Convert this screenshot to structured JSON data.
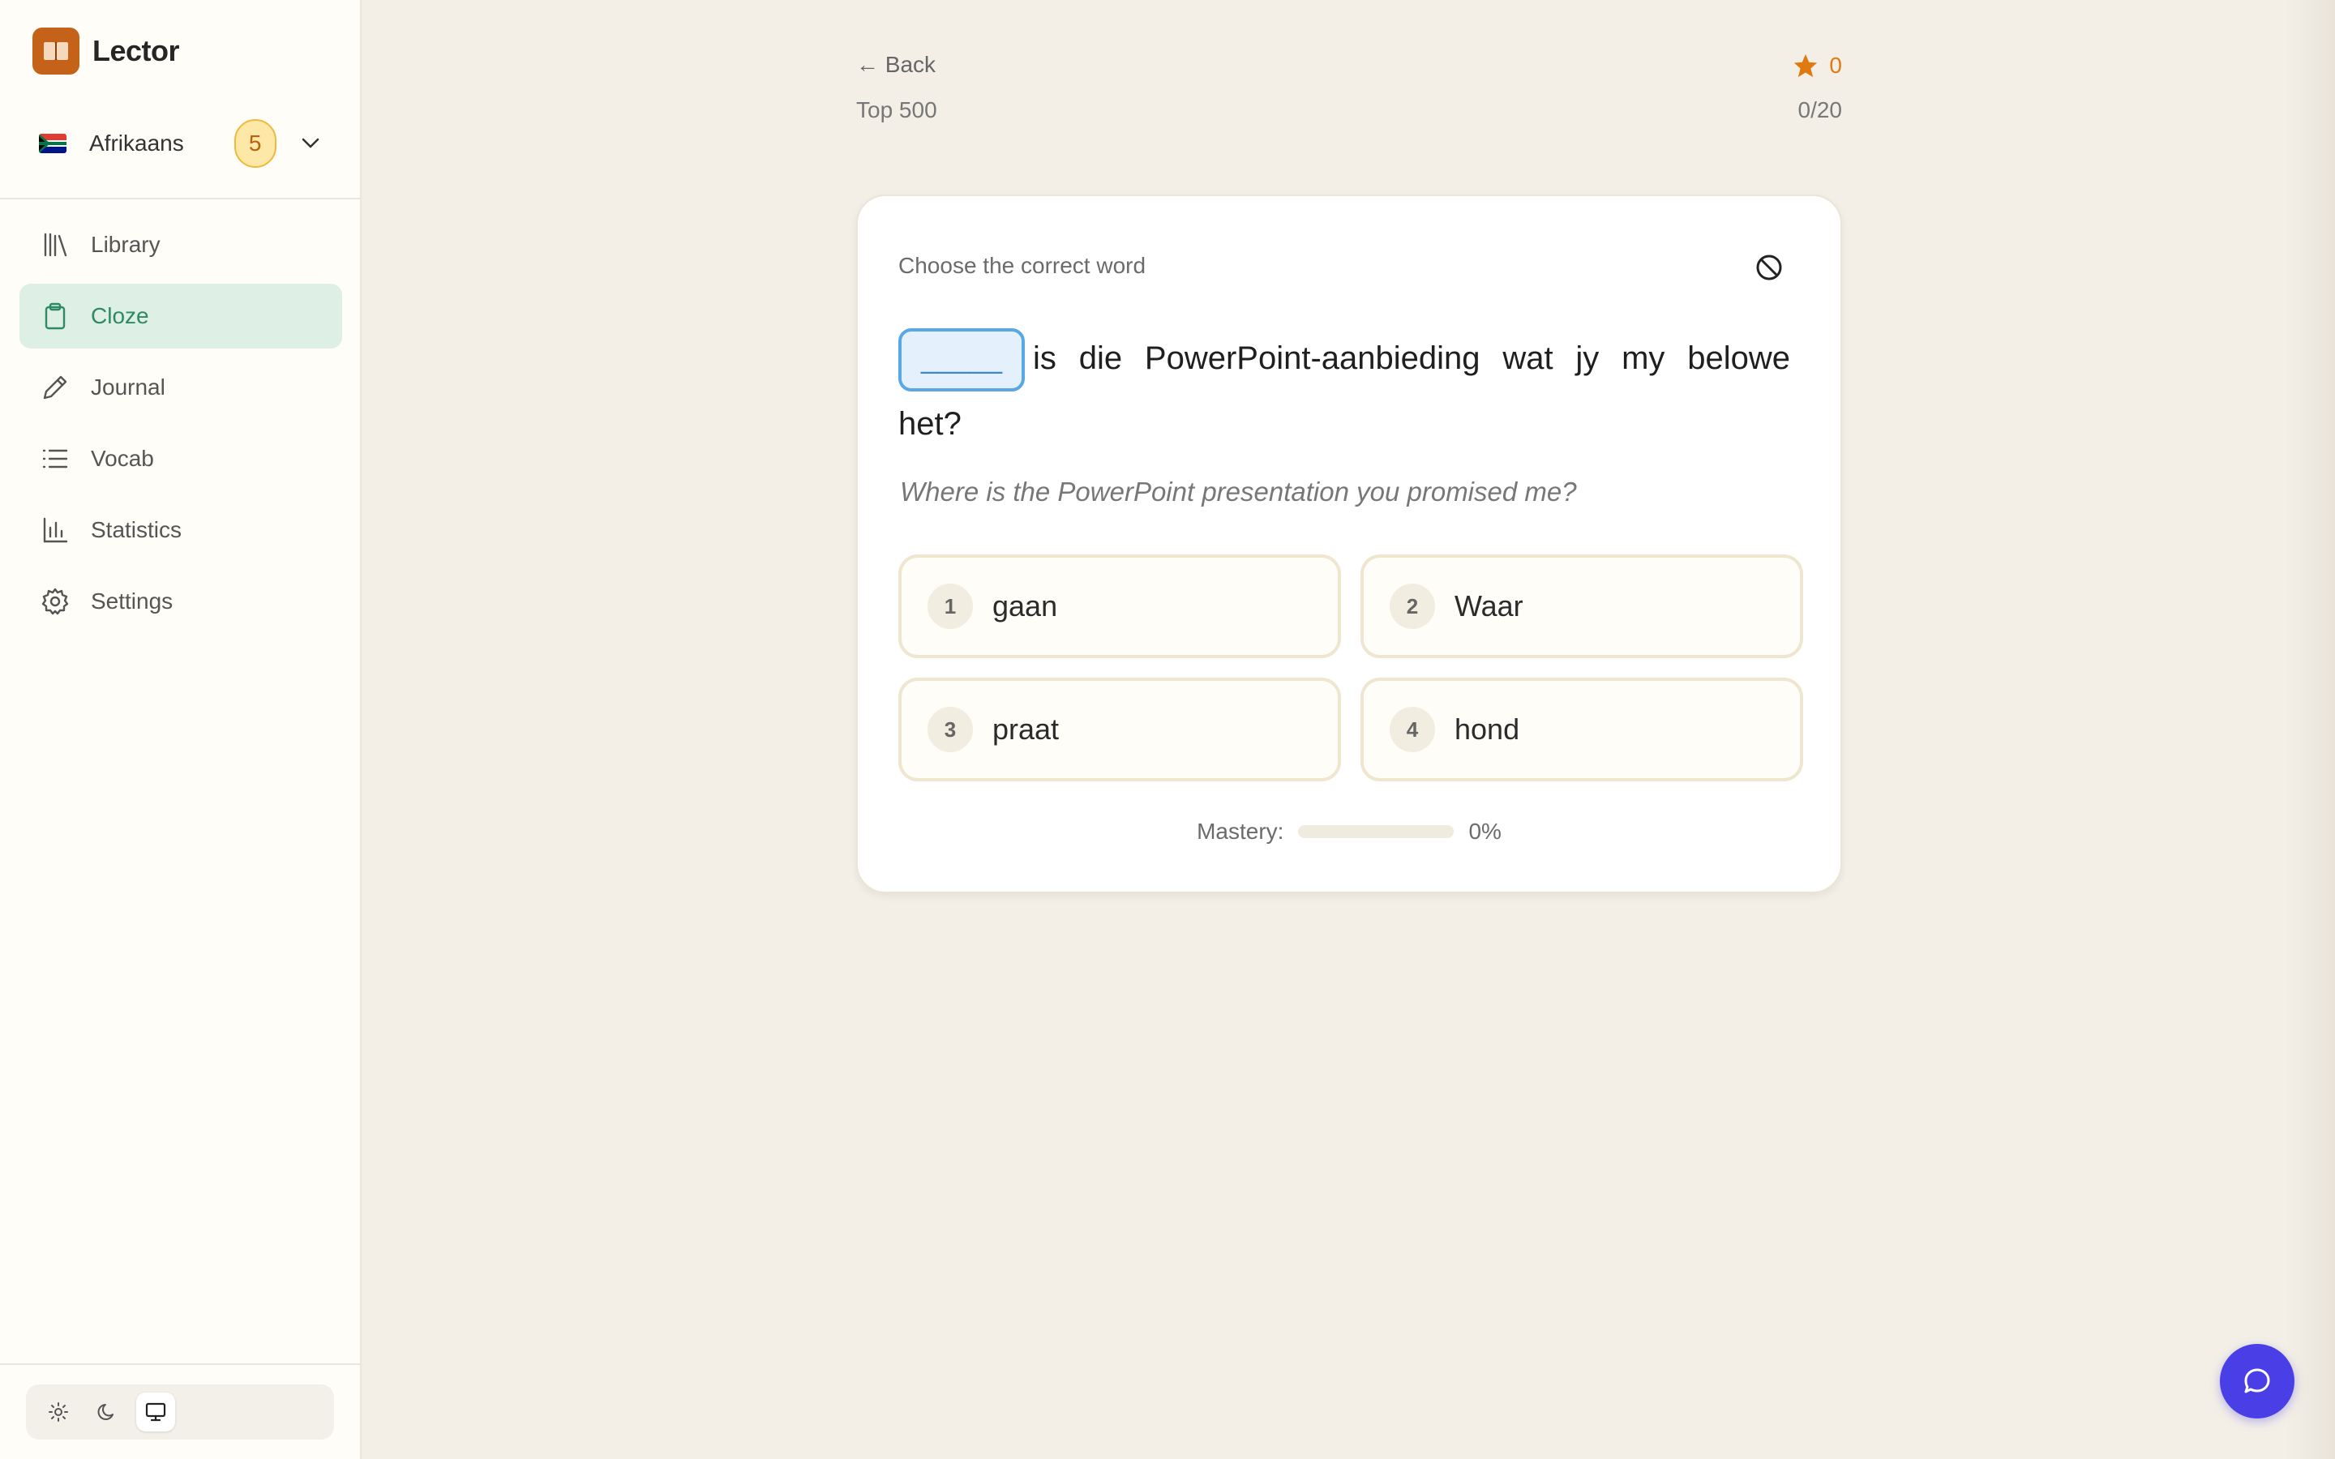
{
  "app": {
    "name": "Lector"
  },
  "language": {
    "name": "Afrikaans",
    "flag": "south-africa-flag",
    "streak": "5"
  },
  "sidebar": {
    "items": [
      {
        "label": "Library",
        "icon": "library-icon"
      },
      {
        "label": "Cloze",
        "icon": "clipboard-icon",
        "active": true
      },
      {
        "label": "Journal",
        "icon": "pencil-icon"
      },
      {
        "label": "Vocab",
        "icon": "list-icon"
      },
      {
        "label": "Statistics",
        "icon": "bar-chart-icon"
      },
      {
        "label": "Settings",
        "icon": "gear-icon"
      }
    ],
    "theme": {
      "options": [
        "light",
        "dark",
        "system"
      ],
      "selected": "system"
    }
  },
  "header": {
    "back_label": "← Back",
    "deck_title": "Top 500",
    "score": "0",
    "progress": "0/20"
  },
  "exercise": {
    "instruction": "Choose the correct word",
    "blank": "_____",
    "sentence_rest": "is die PowerPoint-aanbieding wat jy my belowe het?",
    "translation": "Where is the PowerPoint presentation you promised me?",
    "options": [
      {
        "number": "1",
        "word": "gaan"
      },
      {
        "number": "2",
        "word": "Waar"
      },
      {
        "number": "3",
        "word": "praat"
      },
      {
        "number": "4",
        "word": "hond"
      }
    ],
    "mastery_label": "Mastery:",
    "mastery_value": "0%",
    "mastery_fraction": 0
  },
  "colors": {
    "accent": "#2f8a64",
    "brand": "#c4621a",
    "blank_border": "#5aa7e6",
    "star": "#e07a10",
    "chat_button": "#4a3fe6"
  }
}
